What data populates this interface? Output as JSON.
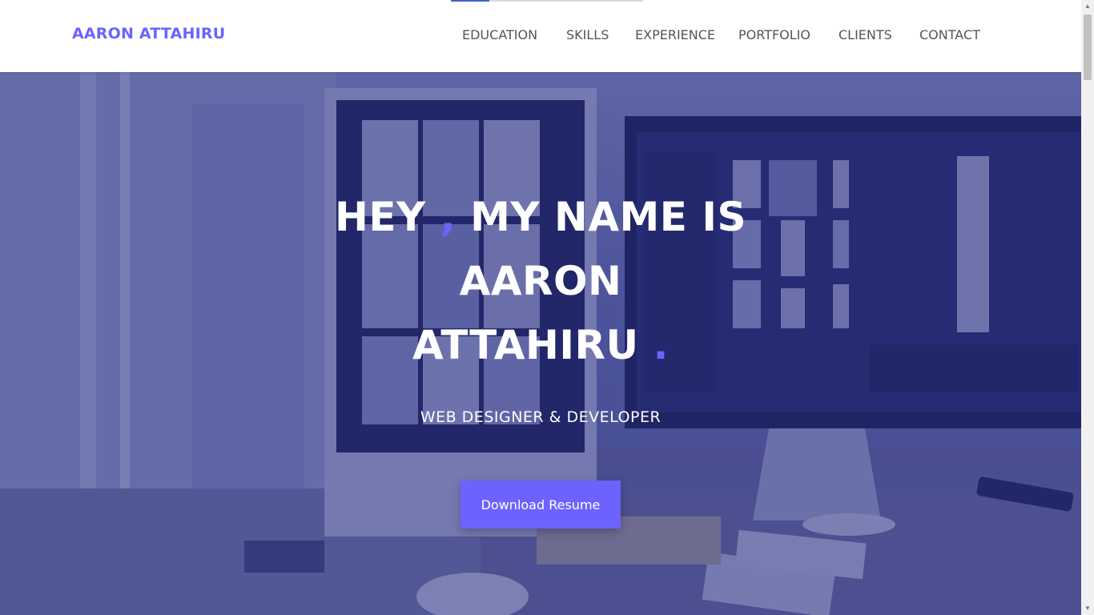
{
  "header": {
    "logo": "AARON ATTAHIRU",
    "scroll_progress": 0.2,
    "nav": [
      {
        "label": "EDUCATION"
      },
      {
        "label": "SKILLS"
      },
      {
        "label": "EXPERIENCE"
      },
      {
        "label": "PORTFOLIO"
      },
      {
        "label": "CLIENTS"
      },
      {
        "label": "CONTACT"
      }
    ]
  },
  "hero": {
    "greeting": "HEY",
    "comma": ",",
    "intro": "MY NAME IS",
    "first_name": "AARON",
    "last_name": "ATTAHIRU",
    "period": ".",
    "subtitle": "WEB DESIGNER & DEVELOPER",
    "cta_label": "Download Resume"
  },
  "theme": {
    "accent": "#6c63ff",
    "overlay": "#22297d"
  },
  "scrollbar": {
    "up_icon": "arrow-up-icon",
    "down_icon": "arrow-down-icon"
  }
}
